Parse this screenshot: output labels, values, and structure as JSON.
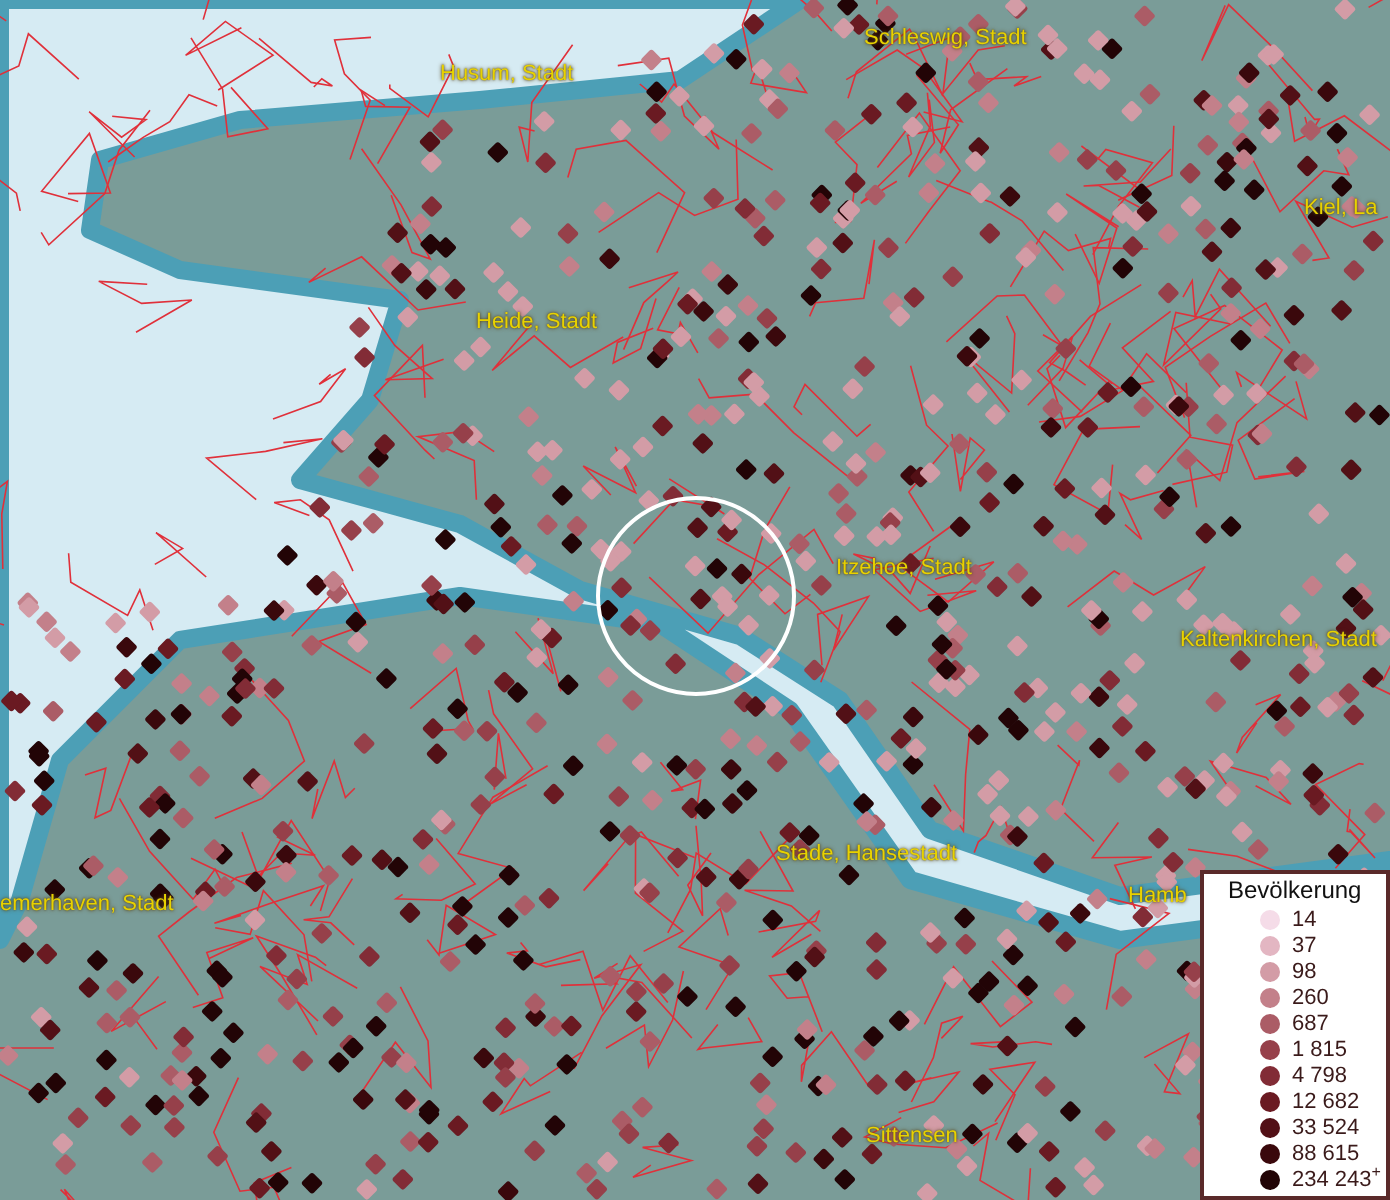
{
  "map": {
    "place_labels": [
      {
        "text": "Schleswig, Stadt"
      },
      {
        "text": "Husum, Stadt"
      },
      {
        "text": "Kiel, La"
      },
      {
        "text": "Heide, Stadt"
      },
      {
        "text": "Itzehoe, Stadt"
      },
      {
        "text": "Kaltenkirchen, Stadt"
      },
      {
        "text": "Stade, Hansestadt"
      },
      {
        "text": "Hamb"
      },
      {
        "text": "emerhaven, Stadt"
      },
      {
        "text": "Sittensen"
      }
    ]
  },
  "legend": {
    "title": "Bevölkerung",
    "items": [
      {
        "label": "14",
        "color": "#f5dce8"
      },
      {
        "label": "37",
        "color": "#e3b6c2"
      },
      {
        "label": "98",
        "color": "#d39ca6"
      },
      {
        "label": "260",
        "color": "#c3808a"
      },
      {
        "label": "687",
        "color": "#ab5c66"
      },
      {
        "label": "1 815",
        "color": "#96404a"
      },
      {
        "label": "4 798",
        "color": "#822c36"
      },
      {
        "label": "12 682",
        "color": "#6a1a22"
      },
      {
        "label": "33 524",
        "color": "#521016"
      },
      {
        "label": "88 615",
        "color": "#3a080c"
      },
      {
        "label": "234 243$^{+}$",
        "color": "#220406"
      }
    ]
  }
}
